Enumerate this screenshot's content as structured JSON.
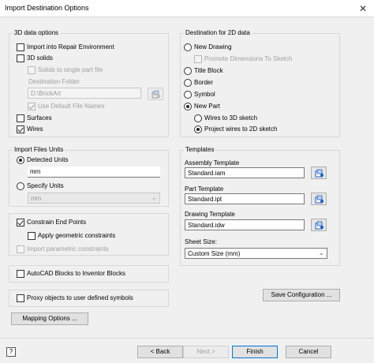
{
  "window": {
    "title": "Import Destination Options",
    "close_glyph": "✕"
  },
  "data3d": {
    "label": "3D data options",
    "repair": {
      "label": "Import into Repair Environment",
      "checked": false
    },
    "solids": {
      "label": "3D solids",
      "checked": false
    },
    "single_part": {
      "label": "Solids to single part file",
      "checked": false
    },
    "dest_folder_label": "Destination Folder",
    "dest_folder_value": "D:\\BrickArt",
    "default_names": {
      "label": "Use Default File Names",
      "checked": true
    },
    "surfaces": {
      "label": "Surfaces",
      "checked": false
    },
    "wires": {
      "label": "Wires",
      "checked": true
    }
  },
  "dest2d": {
    "label": "Destination for 2D data",
    "new_drawing": "New Drawing",
    "promote_dimensions": "Promote Dimensions To Sketch",
    "title_block": "Title Block",
    "border": "Border",
    "symbol": "Symbol",
    "new_part": "New Part",
    "wires_3d": "Wires to 3D sketch",
    "project_2d": "Project wires to 2D sketch"
  },
  "units": {
    "label": "Import Files Units",
    "detected": "Detected Units",
    "detected_value": "mm",
    "specify": "Specify Units",
    "specify_value": "mm"
  },
  "templates": {
    "label": "Templates",
    "assembly_label": "Assembly Template",
    "assembly_value": "Standard.iam",
    "part_label": "Part Template",
    "part_value": "Standard.ipt",
    "drawing_label": "Drawing Template",
    "drawing_value": "Standard.idw",
    "sheet_label": "Sheet Size:",
    "sheet_value": "Custom Size (mm)"
  },
  "constraints": {
    "constrain_end": {
      "label": "Constrain End Points",
      "checked": true
    },
    "apply_geometric": {
      "label": "Apply geometric constraints",
      "checked": false
    },
    "import_parametric": {
      "label": "Import parametric constraints",
      "checked": false
    }
  },
  "autocad_blocks": {
    "label": "AutoCAD Blocks to Inventor Blocks",
    "checked": false
  },
  "proxy_objects": {
    "label": "Proxy objects to user defined symbols",
    "checked": false
  },
  "buttons": {
    "save_config": "Save Configuration ...",
    "mapping": "Mapping Options ...",
    "help": "?",
    "back": "< Back",
    "next": "Next >",
    "finish": "Finish",
    "cancel": "Cancel"
  },
  "colors": {
    "accent": "#0078d7",
    "icon_blue": "#1f5fbf"
  }
}
